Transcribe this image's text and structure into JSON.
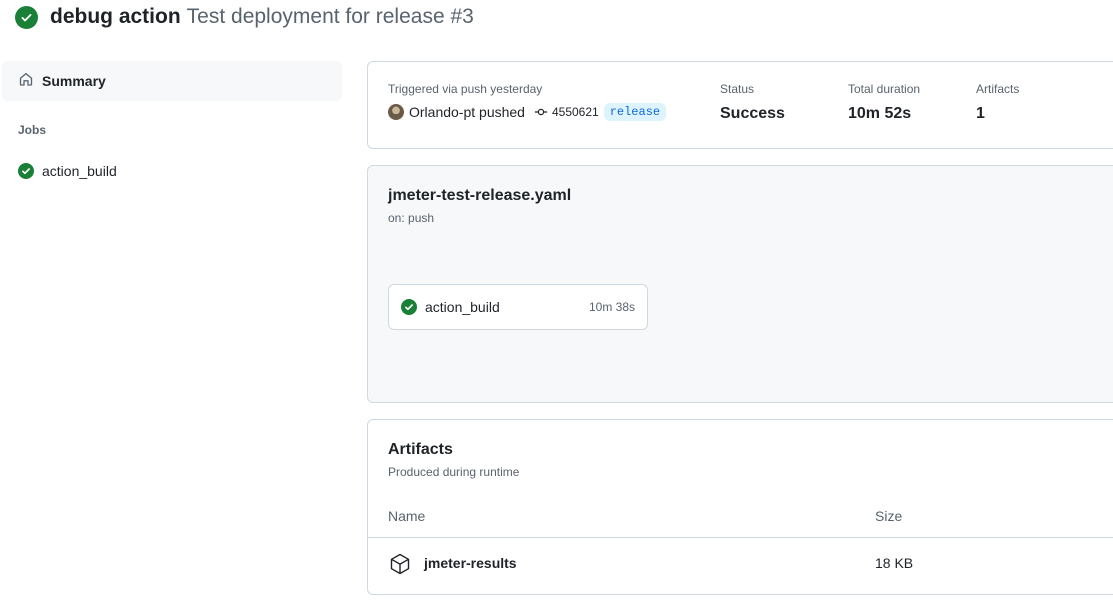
{
  "header": {
    "workflow_name": "debug action",
    "run_title": "Test deployment for release #3"
  },
  "sidebar": {
    "summary_label": "Summary",
    "jobs_heading": "Jobs",
    "jobs": [
      {
        "label": "action_build"
      }
    ]
  },
  "summary": {
    "trigger_label": "Triggered via push yesterday",
    "actor": "Orlando-pt pushed",
    "commit": "4550621",
    "branch": "release",
    "status_label": "Status",
    "status_value": "Success",
    "duration_label": "Total duration",
    "duration_value": "10m 52s",
    "artifacts_label": "Artifacts",
    "artifacts_value": "1"
  },
  "workflow_graph": {
    "file": "jmeter-test-release.yaml",
    "on": "on: push",
    "job_name": "action_build",
    "job_duration": "10m 38s"
  },
  "artifacts": {
    "title": "Artifacts",
    "subtitle": "Produced during runtime",
    "col_name": "Name",
    "col_size": "Size",
    "rows": [
      {
        "name": "jmeter-results",
        "size": "18 KB"
      }
    ]
  },
  "colors": {
    "success": "#1a7f37",
    "link": "#0969da",
    "border": "#d1d9e0",
    "muted": "#59636e"
  },
  "icons": [
    "check-circle-icon",
    "home-icon",
    "git-commit-icon",
    "package-icon"
  ]
}
